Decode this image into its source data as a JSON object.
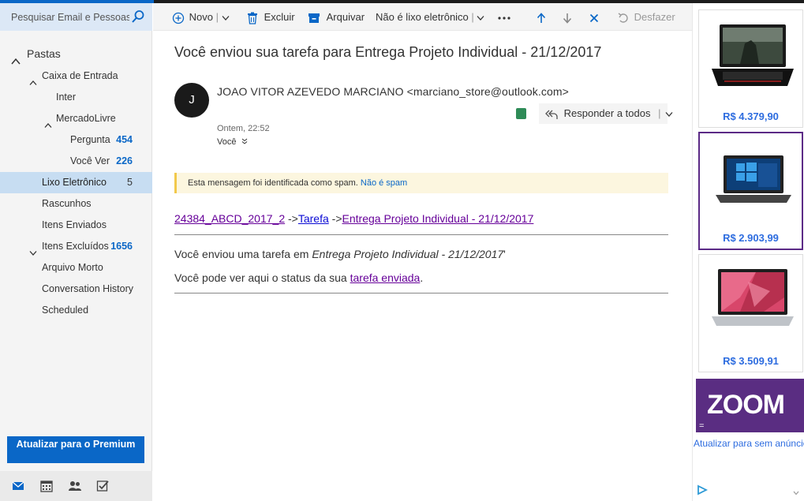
{
  "search": {
    "placeholder": "Pesquisar Email e Pessoas"
  },
  "folders": {
    "header": "Pastas",
    "items": [
      {
        "label": "Caixa de Entrada",
        "count": ""
      },
      {
        "label": "Inter",
        "count": ""
      },
      {
        "label": "MercadoLivre",
        "count": ""
      },
      {
        "label": "Pergunta",
        "count": "454"
      },
      {
        "label": "Você Ver",
        "count": "226"
      },
      {
        "label": "Lixo Eletrônico",
        "count": "5"
      },
      {
        "label": "Rascunhos",
        "count": ""
      },
      {
        "label": "Itens Enviados",
        "count": ""
      },
      {
        "label": "Itens Excluídos",
        "count": "1656"
      },
      {
        "label": "Arquivo Morto",
        "count": ""
      },
      {
        "label": "Conversation History",
        "count": ""
      },
      {
        "label": "Scheduled",
        "count": ""
      }
    ]
  },
  "premium_button": "Atualizar para o Premium",
  "toolbar": {
    "new": "Novo",
    "delete": "Excluir",
    "archive": "Arquivar",
    "not_junk": "Não é lixo eletrônico",
    "undo": "Desfazer"
  },
  "message": {
    "subject": "Você enviou sua tarefa para Entrega Projeto Individual - 21/12/2017",
    "avatar_initial": "J",
    "sender": "JOAO VITOR AZEVEDO MARCIANO <marciano_store@outlook.com>",
    "reply_all": "Responder a todos",
    "date": "Ontem, 22:52",
    "to": "Você",
    "spam_notice": "Esta mensagem foi identificada como spam.",
    "spam_link": "Não é spam",
    "crumb_course": "24384_ABCD_2017_2",
    "crumb_sep1": " ->",
    "crumb_task": "Tarefa",
    "crumb_sep2": " ->",
    "crumb_assignment": "Entrega Projeto Individual - 21/12/2017",
    "body_line1_prefix": "Você enviou uma tarefa em ",
    "body_line1_italic": "Entrega Projeto Individual - 21/12/2017",
    "body_line1_suffix": "'",
    "body_line2_prefix": "Você pode ver aqui o status da sua ",
    "body_line2_link": "tarefa enviada",
    "body_line2_suffix": "."
  },
  "ads": {
    "prices": [
      "R$ 4.379,90",
      "R$ 2.903,99",
      "R$ 3.509,91"
    ],
    "zoom_logo": "ZOOM",
    "upgrade_link": "Atualizar para sem anúncios"
  },
  "colors": {
    "accent": "#0a67c7",
    "link_visited": "#660099",
    "ad_purple": "#5a2d82",
    "price_blue": "#2d6cdf"
  }
}
